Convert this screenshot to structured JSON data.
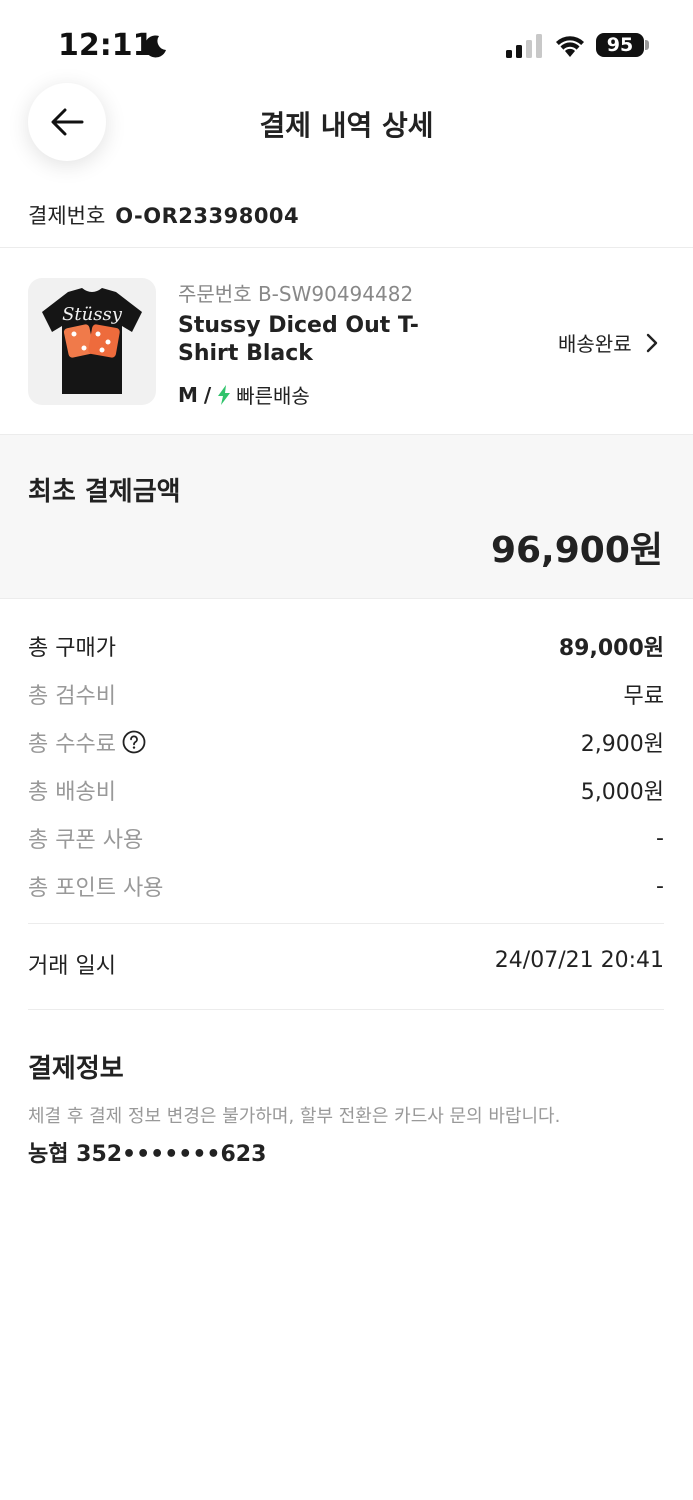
{
  "status_bar": {
    "time": "12:11",
    "battery": "95"
  },
  "header": {
    "title": "결제 내역 상세"
  },
  "payment": {
    "number_label": "결제번호",
    "number_value": "O-OR23398004"
  },
  "product": {
    "order_no": "주문번호 B-SW90494482",
    "name": "Stussy Diced Out T-Shirt Black",
    "size": "M",
    "separator": "/",
    "shipping": "빠른배송",
    "status": "배송완료",
    "thumbnail_logo_text": "Stüssy"
  },
  "initial": {
    "label": "최초 결제금액",
    "amount": "96,900원"
  },
  "breakdown": [
    {
      "label": "총 구매가",
      "value": "89,000원"
    },
    {
      "label": "총 검수비",
      "value": "무료"
    },
    {
      "label": "총 수수료",
      "value": "2,900원"
    },
    {
      "label": "총 배송비",
      "value": "5,000원"
    },
    {
      "label": "총 쿠폰 사용",
      "value": "-"
    },
    {
      "label": "총 포인트 사용",
      "value": "-"
    }
  ],
  "trade": {
    "label": "거래 일시",
    "value": "24/07/21 20:41"
  },
  "payment_info": {
    "title": "결제정보",
    "notice": "체결 후 결제 정보 변경은 불가하며, 할부 전환은 카드사 문의 바랍니다.",
    "card": "농협 352•••••••623"
  },
  "colors": {
    "text": "#222222",
    "muted": "#999999",
    "section_bg": "#f7f7f7",
    "divider": "#ececec",
    "fast_shipping": "#30c36b"
  }
}
